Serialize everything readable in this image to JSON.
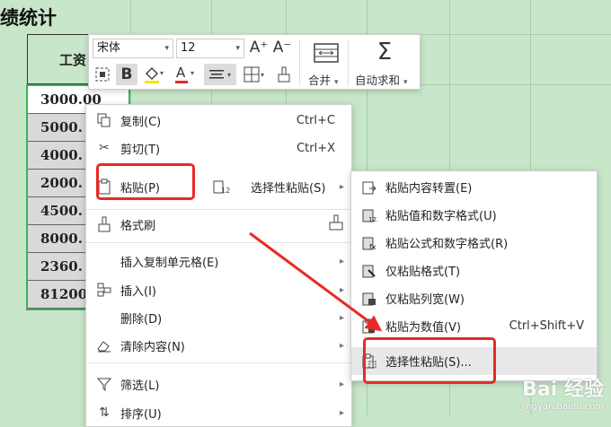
{
  "sheet": {
    "title": "绩统计",
    "column_header": "工资",
    "values": [
      "3000.00",
      "5000.",
      "4000.",
      "2000.",
      "4500.",
      "8000.",
      "2360.",
      "81200."
    ]
  },
  "toolbar": {
    "font_name": "宋体",
    "font_size": "12",
    "increase_font": "A⁺",
    "decrease_font": "A⁻",
    "merge_label": "合并",
    "autosum_label": "自动求和"
  },
  "menu": {
    "items": [
      {
        "label": "复制(C)",
        "shortcut": "Ctrl+C",
        "icon": "copy-icon"
      },
      {
        "label": "剪切(T)",
        "shortcut": "Ctrl+X",
        "icon": "cut-icon"
      },
      {
        "label": "粘贴(P)",
        "icon": "paste-icon"
      },
      {
        "label": "选择性粘贴(S)",
        "icon": "paste-special-icon"
      },
      {
        "label": "格式刷",
        "icon": "format-painter-icon"
      },
      {
        "label": "插入复制单元格(E)"
      },
      {
        "label": "插入(I)",
        "icon": "insert-icon"
      },
      {
        "label": "删除(D)"
      },
      {
        "label": "清除内容(N)",
        "icon": "eraser-icon"
      },
      {
        "label": "筛选(L)",
        "icon": "filter-icon"
      },
      {
        "label": "排序(U)",
        "icon": "sort-icon"
      }
    ]
  },
  "submenu": {
    "items": [
      {
        "label": "粘贴内容转置(E)"
      },
      {
        "label": "粘贴值和数字格式(U)"
      },
      {
        "label": "粘贴公式和数字格式(R)"
      },
      {
        "label": "仅粘贴格式(T)"
      },
      {
        "label": "仅粘贴列宽(W)"
      },
      {
        "label": "粘贴为数值(V)",
        "shortcut": "Ctrl+Shift+V"
      },
      {
        "label": "选择性粘贴(S)..."
      }
    ]
  },
  "watermark": {
    "logo": "Bai 经验",
    "url": "jingyan.baidu.com"
  },
  "colors": {
    "annotation": "#e82a25",
    "sheet_bg": "#c8e6c9",
    "selection": "#3fae5d"
  }
}
